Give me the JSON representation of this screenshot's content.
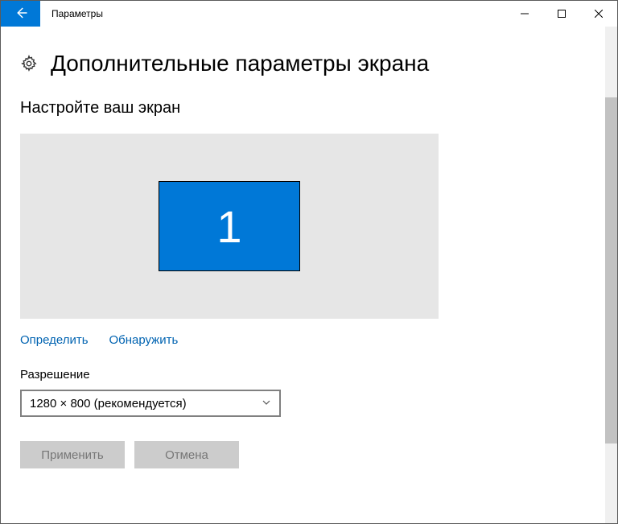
{
  "window": {
    "title": "Параметры"
  },
  "page": {
    "title": "Дополнительные параметры экрана",
    "section_title": "Настройте ваш экран"
  },
  "display": {
    "monitor_number": "1"
  },
  "links": {
    "identify": "Определить",
    "detect": "Обнаружить"
  },
  "resolution": {
    "label": "Разрешение",
    "value": "1280 × 800 (рекомендуется)"
  },
  "buttons": {
    "apply": "Применить",
    "cancel": "Отмена"
  }
}
